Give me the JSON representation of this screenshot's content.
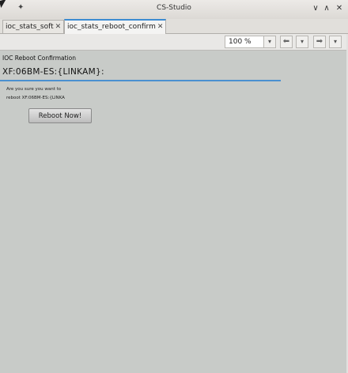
{
  "window": {
    "title": "CS-Studio",
    "pin_glyph": "✦",
    "minimize_glyph": "∨",
    "maximize_glyph": "∧",
    "close_glyph": "✕"
  },
  "tabs": [
    {
      "label": "ioc_stats_soft",
      "close": "✕",
      "active": false
    },
    {
      "label": "ioc_stats_reboot_confirm",
      "close": "✕",
      "active": true
    }
  ],
  "toolbar": {
    "zoom_value": "100 %",
    "dropdown_glyph": "▾",
    "back_glyph": "⬅",
    "forward_glyph": "➡"
  },
  "content": {
    "heading": "IOC Reboot Confirmation",
    "pv_name": "XF:06BM-ES:{LINKAM}:",
    "message_line1": "Are you sure you want to",
    "message_line2": "reboot XF:06BM-ES:{LINKA",
    "reboot_button": "Reboot Now!"
  },
  "colors": {
    "accent": "#3c8cd2",
    "background": "#c8cbc8"
  }
}
